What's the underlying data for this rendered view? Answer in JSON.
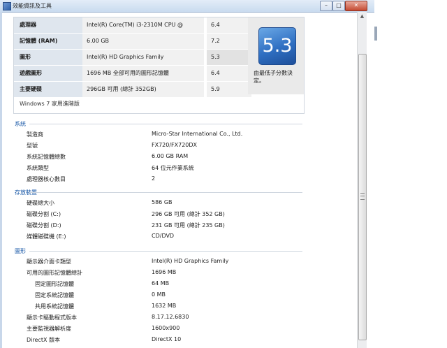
{
  "window": {
    "title": "效能資訊及工具",
    "buttons": {
      "minimize": "–",
      "maximize": "□",
      "close": "✕"
    }
  },
  "score_table": {
    "rows": [
      {
        "label": "處理器",
        "value": "Intel(R) Core(TM) i3-2310M CPU @ 2.10GHz",
        "score": "6.4"
      },
      {
        "label": "記憶體 (RAM)",
        "value": "6.00 GB",
        "score": "7.2"
      },
      {
        "label": "圖形",
        "value": "Intel(R) HD Graphics Family",
        "score": "5.3"
      },
      {
        "label": "遊戲圖形",
        "value": "1696 MB 全部可用的圖形記憶體",
        "score": "6.4"
      },
      {
        "label": "主要硬碟",
        "value": "296GB 可用 (總計 352GB)",
        "score": "5.9"
      }
    ],
    "base_score": "5.3",
    "base_score_note": "由最低子分數決定。",
    "edition": "Windows 7 家用進階版"
  },
  "sections": [
    {
      "title": "系統",
      "rows": [
        {
          "label": "製造商",
          "value": "Micro-Star International Co., Ltd.",
          "indent": 1
        },
        {
          "label": "型號",
          "value": "FX720/FX720DX",
          "indent": 1
        },
        {
          "label": "系統記憶體總數",
          "value": "6.00 GB RAM",
          "indent": 1
        },
        {
          "label": "系統類型",
          "value": "64 位元作業系統",
          "indent": 1
        },
        {
          "label": "處理器核心數目",
          "value": "2",
          "indent": 1
        }
      ]
    },
    {
      "title": "存放裝置",
      "rows": [
        {
          "label": "硬碟總大小",
          "value": "586 GB",
          "indent": 1
        },
        {
          "label": "磁碟分割 (C:)",
          "value": "296 GB 可用 (總計 352 GB)",
          "indent": 1
        },
        {
          "label": "磁碟分割 (D:)",
          "value": "231 GB 可用 (總計 235 GB)",
          "indent": 1
        },
        {
          "label": "媒體磁碟機 (E:)",
          "value": "CD/DVD",
          "indent": 1
        }
      ]
    },
    {
      "title": "圖形",
      "rows": [
        {
          "label": "顯示器介面卡類型",
          "value": "Intel(R) HD Graphics Family",
          "indent": 1
        },
        {
          "label": "可用的圖形記憶體總計",
          "value": "1696 MB",
          "indent": 1
        },
        {
          "label": "固定圖形記憶體",
          "value": "64 MB",
          "indent": 2
        },
        {
          "label": "固定系統記憶體",
          "value": "0 MB",
          "indent": 2
        },
        {
          "label": "共用系統記憶體",
          "value": "1632 MB",
          "indent": 2
        },
        {
          "label": "顯示卡驅動程式版本",
          "value": "8.17.12.6830",
          "indent": 1
        },
        {
          "label": "主要監視器解析度",
          "value": "1600x900",
          "indent": 1
        },
        {
          "label": "DirectX 版本",
          "value": "DirectX 10",
          "indent": 1
        }
      ]
    }
  ],
  "icons": {
    "app": "performance-info-icon",
    "scroll_up": "arrow-up-icon",
    "grip": "scroll-grip-icon"
  },
  "colors": {
    "section_heading": "#1b5aa8",
    "badge": "#2f6fc2",
    "label_cell": "#dfe6ee",
    "value_cell": "#f1f1f1"
  }
}
